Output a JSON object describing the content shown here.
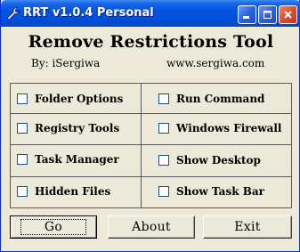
{
  "window": {
    "title": "RRT v1.0.4 Personal",
    "title_icon": "wrench-icon",
    "controls": {
      "minimize_icon": "minimize-icon",
      "maximize_icon": "maximize-icon",
      "close_icon": "close-icon"
    },
    "titlebar_color": "#0055E5",
    "close_color": "#D6512F"
  },
  "header": {
    "title": "Remove Restrictions Tool",
    "byline": "By: iSergiwa",
    "website": "www.sergiwa.com"
  },
  "options": {
    "left": [
      {
        "label": "Folder Options",
        "checked": false
      },
      {
        "label": "Registry Tools",
        "checked": false
      },
      {
        "label": "Task Manager",
        "checked": false
      },
      {
        "label": "Hidden Files",
        "checked": false
      }
    ],
    "right": [
      {
        "label": "Run Command",
        "checked": false
      },
      {
        "label": "Windows Firewall",
        "checked": false
      },
      {
        "label": "Show Desktop",
        "checked": false
      },
      {
        "label": "Show Task Bar",
        "checked": false
      }
    ]
  },
  "buttons": {
    "go": "Go",
    "about": "About",
    "exit": "Exit"
  }
}
